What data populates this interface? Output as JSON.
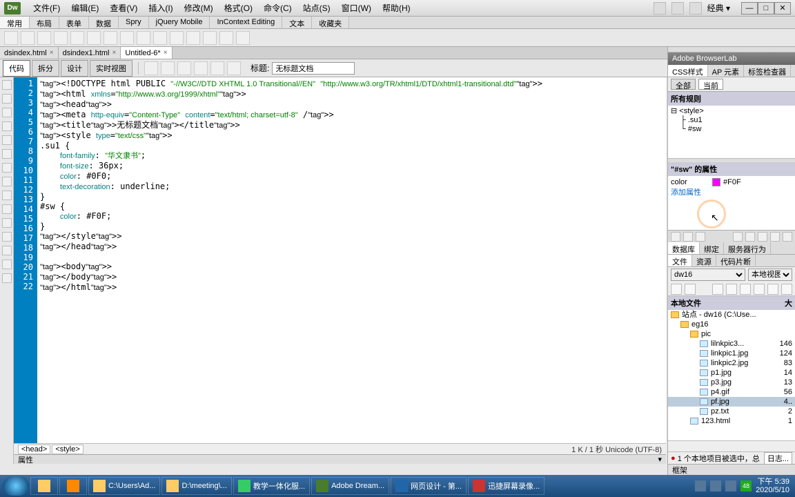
{
  "menubar": {
    "logo": "Dw",
    "items": [
      "文件(F)",
      "编辑(E)",
      "查看(V)",
      "插入(I)",
      "修改(M)",
      "格式(O)",
      "命令(C)",
      "站点(S)",
      "窗口(W)",
      "帮助(H)"
    ],
    "layout": "经典 ▾"
  },
  "insertbar": {
    "tabs": [
      "常用",
      "布局",
      "表单",
      "数据",
      "Spry",
      "jQuery Mobile",
      "InContext Editing",
      "文本",
      "收藏夹"
    ],
    "activeIndex": 0
  },
  "docTabs": {
    "tabs": [
      "dsindex.html",
      "dsindex1.html",
      "Untitled-6*"
    ],
    "activeIndex": 2
  },
  "docToolbar": {
    "views": [
      "代码",
      "拆分",
      "设计",
      "实时视图"
    ],
    "activeIndex": 0,
    "titleLabel": "标题:",
    "titleValue": "无标题文档"
  },
  "code": {
    "lines": [
      "<!DOCTYPE html PUBLIC \"-//W3C//DTD XHTML 1.0 Transitional//EN\" \"http://www.w3.org/TR/xhtml1/DTD/xhtml1-transitional.dtd\">",
      "<html xmlns=\"http://www.w3.org/1999/xhtml\">",
      "<head>",
      "<meta http-equiv=\"Content-Type\" content=\"text/html; charset=utf-8\" />",
      "<title>无标题文档</title>",
      "<style type=\"text/css\">",
      ".su1 {",
      "    font-family: \"华文隶书\";",
      "    font-size: 36px;",
      "    color: #0F0;",
      "    text-decoration: underline;",
      "}",
      "#sw {",
      "    color: #F0F;",
      "}",
      "</style>",
      "</head>",
      "",
      "<body>",
      "</body>",
      "</html>",
      ""
    ]
  },
  "tagSelector": {
    "crumbs": [
      "<head>",
      "<style>"
    ],
    "status": "1 K / 1 秒 Unicode (UTF-8)"
  },
  "propsPanel": {
    "title": "属性"
  },
  "rightPanels": {
    "browserlab": "Adobe BrowserLab",
    "cssTabs": [
      "CSS样式",
      "AP 元素",
      "标签检查器"
    ],
    "cssFilter": {
      "all": "全部",
      "current": "当前"
    },
    "rulesTitle": "所有规则",
    "rulesTree": [
      "<style>",
      ".su1",
      "#sw"
    ],
    "propsTitle": "\"#sw\" 的属性",
    "propColor": {
      "label": "color",
      "value": "#F0F"
    },
    "addProp": "添加属性",
    "dbTabs": [
      "数据库",
      "绑定",
      "服务器行为"
    ],
    "fileTabs": [
      "文件",
      "资源",
      "代码片断"
    ],
    "siteSelect": "dw16",
    "viewSelect": "本地视图",
    "fileHeader": {
      "name": "本地文件",
      "size": "大"
    },
    "files": [
      {
        "name": "站点 - dw16 (C:\\Use...",
        "depth": 0,
        "type": "folder",
        "size": ""
      },
      {
        "name": "eg16",
        "depth": 1,
        "type": "folder",
        "size": ""
      },
      {
        "name": "pic",
        "depth": 2,
        "type": "folder",
        "size": ""
      },
      {
        "name": "lilnkpic3...",
        "depth": 3,
        "type": "file",
        "size": "146"
      },
      {
        "name": "linkpic1.jpg",
        "depth": 3,
        "type": "file",
        "size": "124"
      },
      {
        "name": "linkpic2.jpg",
        "depth": 3,
        "type": "file",
        "size": "83"
      },
      {
        "name": "p1.jpg",
        "depth": 3,
        "type": "file",
        "size": "14"
      },
      {
        "name": "p3.jpg",
        "depth": 3,
        "type": "file",
        "size": "13"
      },
      {
        "name": "p4.gif",
        "depth": 3,
        "type": "file",
        "size": "56"
      },
      {
        "name": "pf.jpg",
        "depth": 3,
        "type": "file",
        "size": "4..",
        "selected": true
      },
      {
        "name": "pz.txt",
        "depth": 3,
        "type": "file",
        "size": "2"
      },
      {
        "name": "123.html",
        "depth": 2,
        "type": "file",
        "size": "1"
      }
    ],
    "fileStatus": "1 个本地项目被选中，总",
    "fileStatusBtn": "日志...",
    "frameTitle": "框架"
  },
  "taskbar": {
    "tasks": [
      "C:\\Users\\Ad...",
      "D:\\meeting\\...",
      "教学一体化服...",
      "Adobe Dream...",
      "网页设计 - 第...",
      "迅捷屏幕录像..."
    ],
    "clock": {
      "time": "下午 5:39",
      "date": "2020/5/10"
    }
  }
}
